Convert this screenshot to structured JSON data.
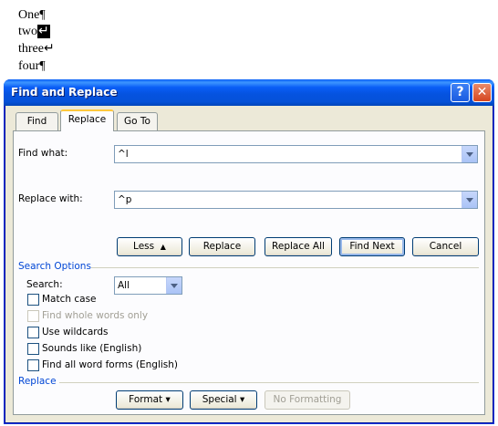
{
  "document": {
    "lines": [
      {
        "text": "One",
        "mark": "¶"
      },
      {
        "text": "two",
        "mark": "↵"
      },
      {
        "text": "three",
        "mark": "↵"
      },
      {
        "text": "four",
        "mark": "¶"
      }
    ]
  },
  "dialog": {
    "title": "Find and Replace",
    "help_icon": "question-mark-icon",
    "close_icon": "close-icon",
    "tabs": [
      {
        "label": "Find",
        "active": false
      },
      {
        "label": "Replace",
        "active": true
      },
      {
        "label": "Go To",
        "active": false
      }
    ],
    "find_what": {
      "label": "Find what:",
      "value": "^l"
    },
    "replace_with": {
      "label": "Replace with:",
      "value": "^p"
    },
    "buttons": {
      "less": "Less",
      "less_arrow": "▲",
      "replace": "Replace",
      "replace_all": "Replace All",
      "find_next": "Find Next",
      "cancel": "Cancel"
    },
    "search_options": {
      "title": "Search Options",
      "search_label": "Search:",
      "search_value": "All",
      "checkboxes": [
        {
          "label": "Match case",
          "checked": false,
          "enabled": true
        },
        {
          "label": "Find whole words only",
          "checked": false,
          "enabled": false
        },
        {
          "label": "Use wildcards",
          "checked": false,
          "enabled": true
        },
        {
          "label": "Sounds like (English)",
          "checked": false,
          "enabled": true
        },
        {
          "label": "Find all word forms (English)",
          "checked": false,
          "enabled": true
        }
      ]
    },
    "replace_section": {
      "title": "Replace",
      "format": "Format",
      "special": "Special",
      "arrow": "▾",
      "no_formatting": "No Formatting"
    }
  },
  "colors": {
    "titlebar": "#0553e0",
    "dialog_bg": "#ece9d8",
    "section_title": "#0046d5"
  }
}
